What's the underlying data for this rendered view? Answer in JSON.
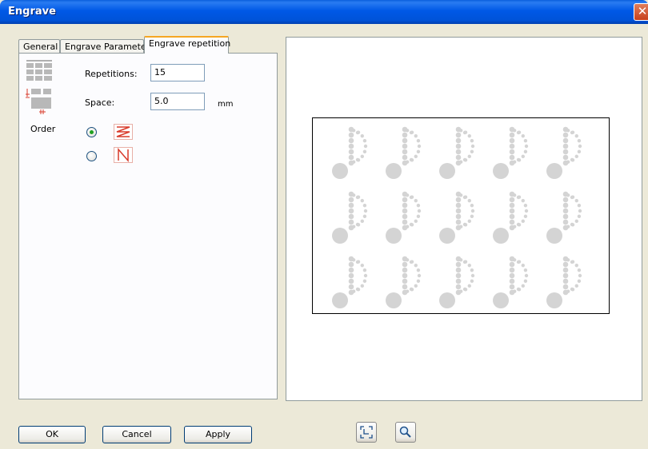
{
  "window": {
    "title": "Engrave",
    "close_symbol": "✕"
  },
  "tabs": [
    {
      "label": "General"
    },
    {
      "label": "Engrave Parameter"
    },
    {
      "label": "Engrave repetition"
    }
  ],
  "repetition": {
    "repetitions_label": "Repetitions:",
    "repetitions_value": "15",
    "space_label": "Space:",
    "space_value": "5.0",
    "space_unit": "mm",
    "order_label": "Order"
  },
  "buttons": {
    "ok": "OK",
    "cancel": "Cancel",
    "apply": "Apply"
  },
  "preview": {
    "rows": 3,
    "cols": 5
  },
  "icons": {
    "grid": "grid-repetitions-icon",
    "spacing": "spacing-icon",
    "order_row": "order-row-icon",
    "order_column": "order-column-icon",
    "fit": "fit-view-icon",
    "zoom": "zoom-icon"
  },
  "colors": {
    "titlebar": "#0058e6",
    "active_tab_accent": "#f5a623",
    "order_icon": "#d83a2a",
    "preview_dots": "#d4d4d4"
  }
}
